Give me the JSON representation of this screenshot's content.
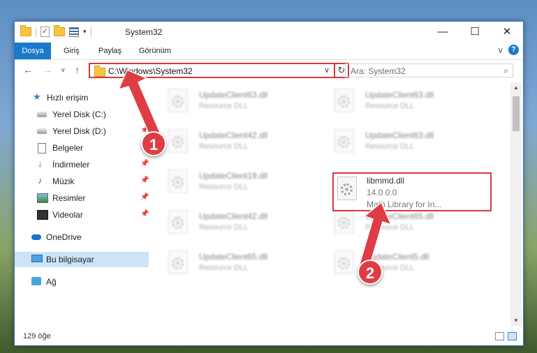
{
  "window": {
    "title": "System32",
    "minimize": "—",
    "maximize": "☐",
    "close": "✕"
  },
  "ribbon": {
    "tabs": [
      "Dosya",
      "Giriş",
      "Paylaş",
      "Görünüm"
    ],
    "help": "?",
    "collapse": "∨"
  },
  "nav": {
    "back": "←",
    "forward": "→",
    "recent": "∨",
    "up": "↑",
    "address": "C:\\Windows\\System32",
    "address_dropdown": "∨",
    "refresh": "↻",
    "search_placeholder": "Ara: System32",
    "search_icon": "⌕"
  },
  "sidebar": {
    "items": [
      {
        "label": "Hızlı erişim",
        "icon": "star-icon"
      },
      {
        "label": "Yerel Disk (C:)",
        "icon": "disk-icon"
      },
      {
        "label": "Yerel Disk (D:)",
        "icon": "disk-icon",
        "pinned": true
      },
      {
        "label": "Belgeler",
        "icon": "document-icon",
        "pinned": true
      },
      {
        "label": "İndirmeler",
        "icon": "download-icon",
        "pinned": true
      },
      {
        "label": "Müzik",
        "icon": "music-icon",
        "pinned": true
      },
      {
        "label": "Resimler",
        "icon": "pictures-icon",
        "pinned": true
      },
      {
        "label": "Videolar",
        "icon": "videos-icon",
        "pinned": true
      },
      {
        "label": "OneDrive",
        "icon": "cloud-icon"
      },
      {
        "label": "Bu bilgisayar",
        "icon": "computer-icon",
        "selected": true
      },
      {
        "label": "Ağ",
        "icon": "network-icon"
      }
    ],
    "pin_glyph": "📌"
  },
  "files": [
    {
      "name": "UpdateClient63.dll",
      "desc": "Resource DLL"
    },
    {
      "name": "UpdateClient63.dll",
      "desc": "Resource DLL"
    },
    {
      "name": "UpdateClient42.dll",
      "desc": "Resource DLL"
    },
    {
      "name": "UpdateClient63.dll",
      "desc": "Resource DLL"
    },
    {
      "name": "UpdateClient19.dll",
      "desc": "Resource DLL"
    },
    {
      "name": "libmmd.dll",
      "version": "14.0.0.0",
      "desc": "Math Library for In..."
    },
    {
      "name": "UpdateClient42.dll",
      "desc": "Resource DLL"
    },
    {
      "name": "UpdateClient65.dll",
      "desc": "Resource DLL"
    },
    {
      "name": "UpdateClient65.dll",
      "desc": "Resource DLL"
    },
    {
      "name": "UpdateClient5.dll",
      "desc": "Resource DLL"
    }
  ],
  "status": {
    "count": "129 öğe"
  },
  "annotations": {
    "step1": "1",
    "step2": "2",
    "accent": "#d9363e"
  },
  "scrollbar": {
    "up": "▲",
    "down": "▼"
  }
}
